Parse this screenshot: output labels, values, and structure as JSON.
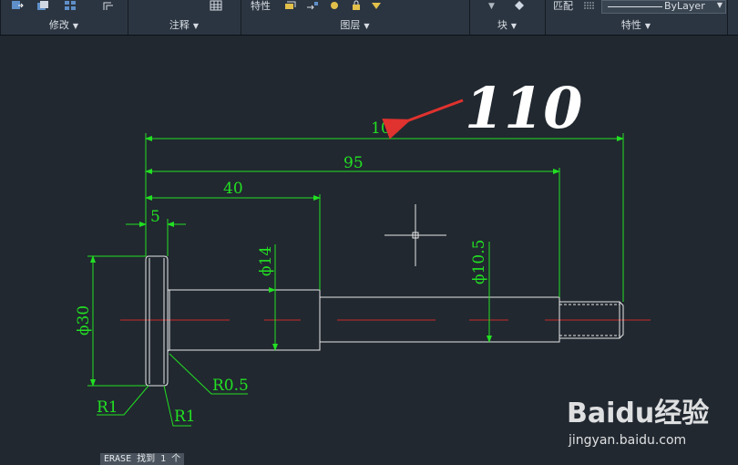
{
  "ribbon": {
    "panels": [
      {
        "label": "修改"
      },
      {
        "label": "注释"
      },
      {
        "label": "图层"
      },
      {
        "label": "块"
      },
      {
        "label": "特性"
      }
    ],
    "layer_properties_label": "特性",
    "match_label": "匹配",
    "bylayer_label": "ByLayer"
  },
  "drawing": {
    "dimensions": {
      "overall": "109",
      "length_95": "95",
      "length_40": "40",
      "length_5": "5",
      "dia_30": "ϕ30",
      "dia_14": "ϕ14",
      "dia_10_5": "ϕ10.5",
      "radius_r05": "R0.5",
      "radius_r1_left": "R1",
      "radius_r1_right": "R1"
    },
    "handwritten_annotation": "110",
    "colors": {
      "dimension": "#22e022",
      "geometry": "#e8e8e8",
      "centerline": "#cc2a2a",
      "arrow": "#e0322e"
    }
  },
  "command_line": {
    "text": "ERASE 找到 1 个"
  },
  "watermark": {
    "brand": "Baidu经验",
    "url": "jingyan.baidu.com"
  }
}
